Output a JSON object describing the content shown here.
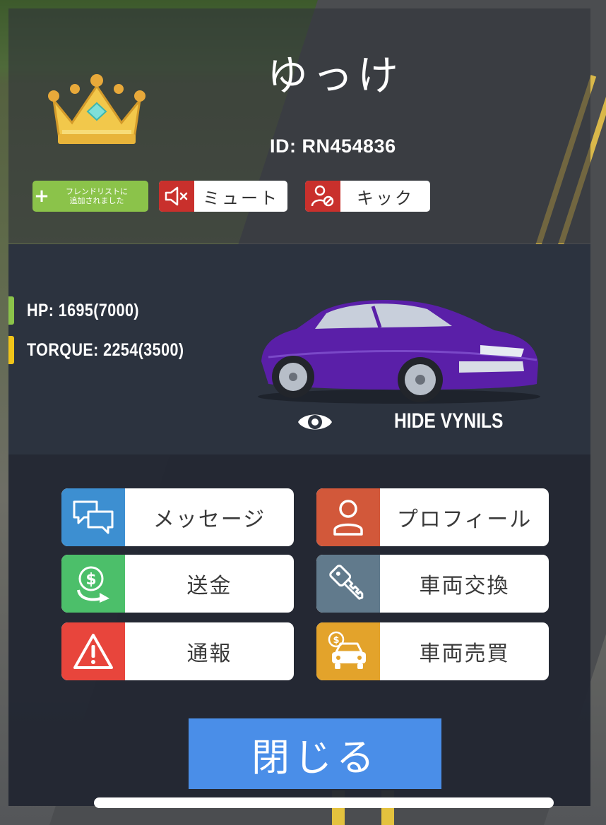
{
  "player": {
    "name": "ゆっけ",
    "id": "ID: RN454836"
  },
  "badges": {
    "friend_added": "フレンドリストに\n追加されました"
  },
  "chips": {
    "mute_label": "ミュート",
    "kick_label": "キック"
  },
  "vehicle": {
    "hp_text": "HP: 1695(7000)",
    "torque_text": "TORQUE: 2254(3500)",
    "hide_vinyls_label": "HIDE VYNILS",
    "hp_color": "#8bc34a",
    "torque_color": "#f0c419",
    "car_color": "#5a1fa8"
  },
  "actions": {
    "message": {
      "label": "メッセージ",
      "color": "#3d8fd1",
      "icon": "chat-bubbles-icon"
    },
    "profile": {
      "label": "プロフィール",
      "color": "#d2583a",
      "icon": "user-icon"
    },
    "transfer": {
      "label": "送金",
      "color": "#4cbf6a",
      "icon": "money-transfer-icon"
    },
    "swap": {
      "label": "車両交換",
      "color": "#617a8c",
      "icon": "key-icon"
    },
    "report": {
      "label": "通報",
      "color": "#e8453c",
      "icon": "warning-icon"
    },
    "trade": {
      "label": "車両売買",
      "color": "#e3a32b",
      "icon": "car-sale-icon"
    }
  },
  "close_label": "閉じる"
}
